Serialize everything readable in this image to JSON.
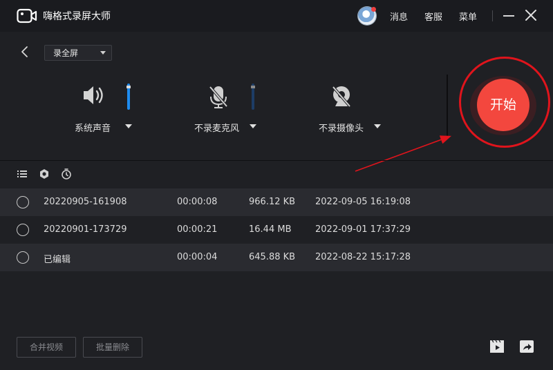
{
  "app": {
    "title": "嗨格式录屏大师",
    "menu": {
      "news": "消息",
      "service": "客服",
      "menu": "菜单"
    }
  },
  "controls": {
    "mode": "录全屏",
    "system_audio": {
      "label": "系统声音",
      "icon": "speaker-icon",
      "level": 0.75,
      "color": "#1e8cf0"
    },
    "microphone": {
      "label": "不录麦克风",
      "icon": "mic-off-icon",
      "level": 0.75,
      "color": "#1d3d66"
    },
    "camera": {
      "label": "不录摄像头",
      "icon": "camera-off-icon"
    },
    "start_label": "开始",
    "start_color": "#f3473e"
  },
  "toolbar": {
    "icons": [
      "list-icon",
      "settings-hex-icon",
      "timer-icon"
    ]
  },
  "files": [
    {
      "name": "20220905-161908",
      "duration": "00:00:08",
      "size": "966.12 KB",
      "date": "2022-09-05 16:19:08"
    },
    {
      "name": "20220901-173729",
      "duration": "00:00:21",
      "size": "16.44 MB",
      "date": "2022-09-01 17:37:29"
    },
    {
      "name": "已编辑",
      "duration": "00:00:04",
      "size": "645.88 KB",
      "date": "2022-08-22 15:17:28"
    }
  ],
  "footer": {
    "merge": "合并视频",
    "batch_delete": "批量删除",
    "icons": [
      "video-folder-icon",
      "share-icon"
    ]
  },
  "annotation": {
    "color": "#e0141c"
  }
}
